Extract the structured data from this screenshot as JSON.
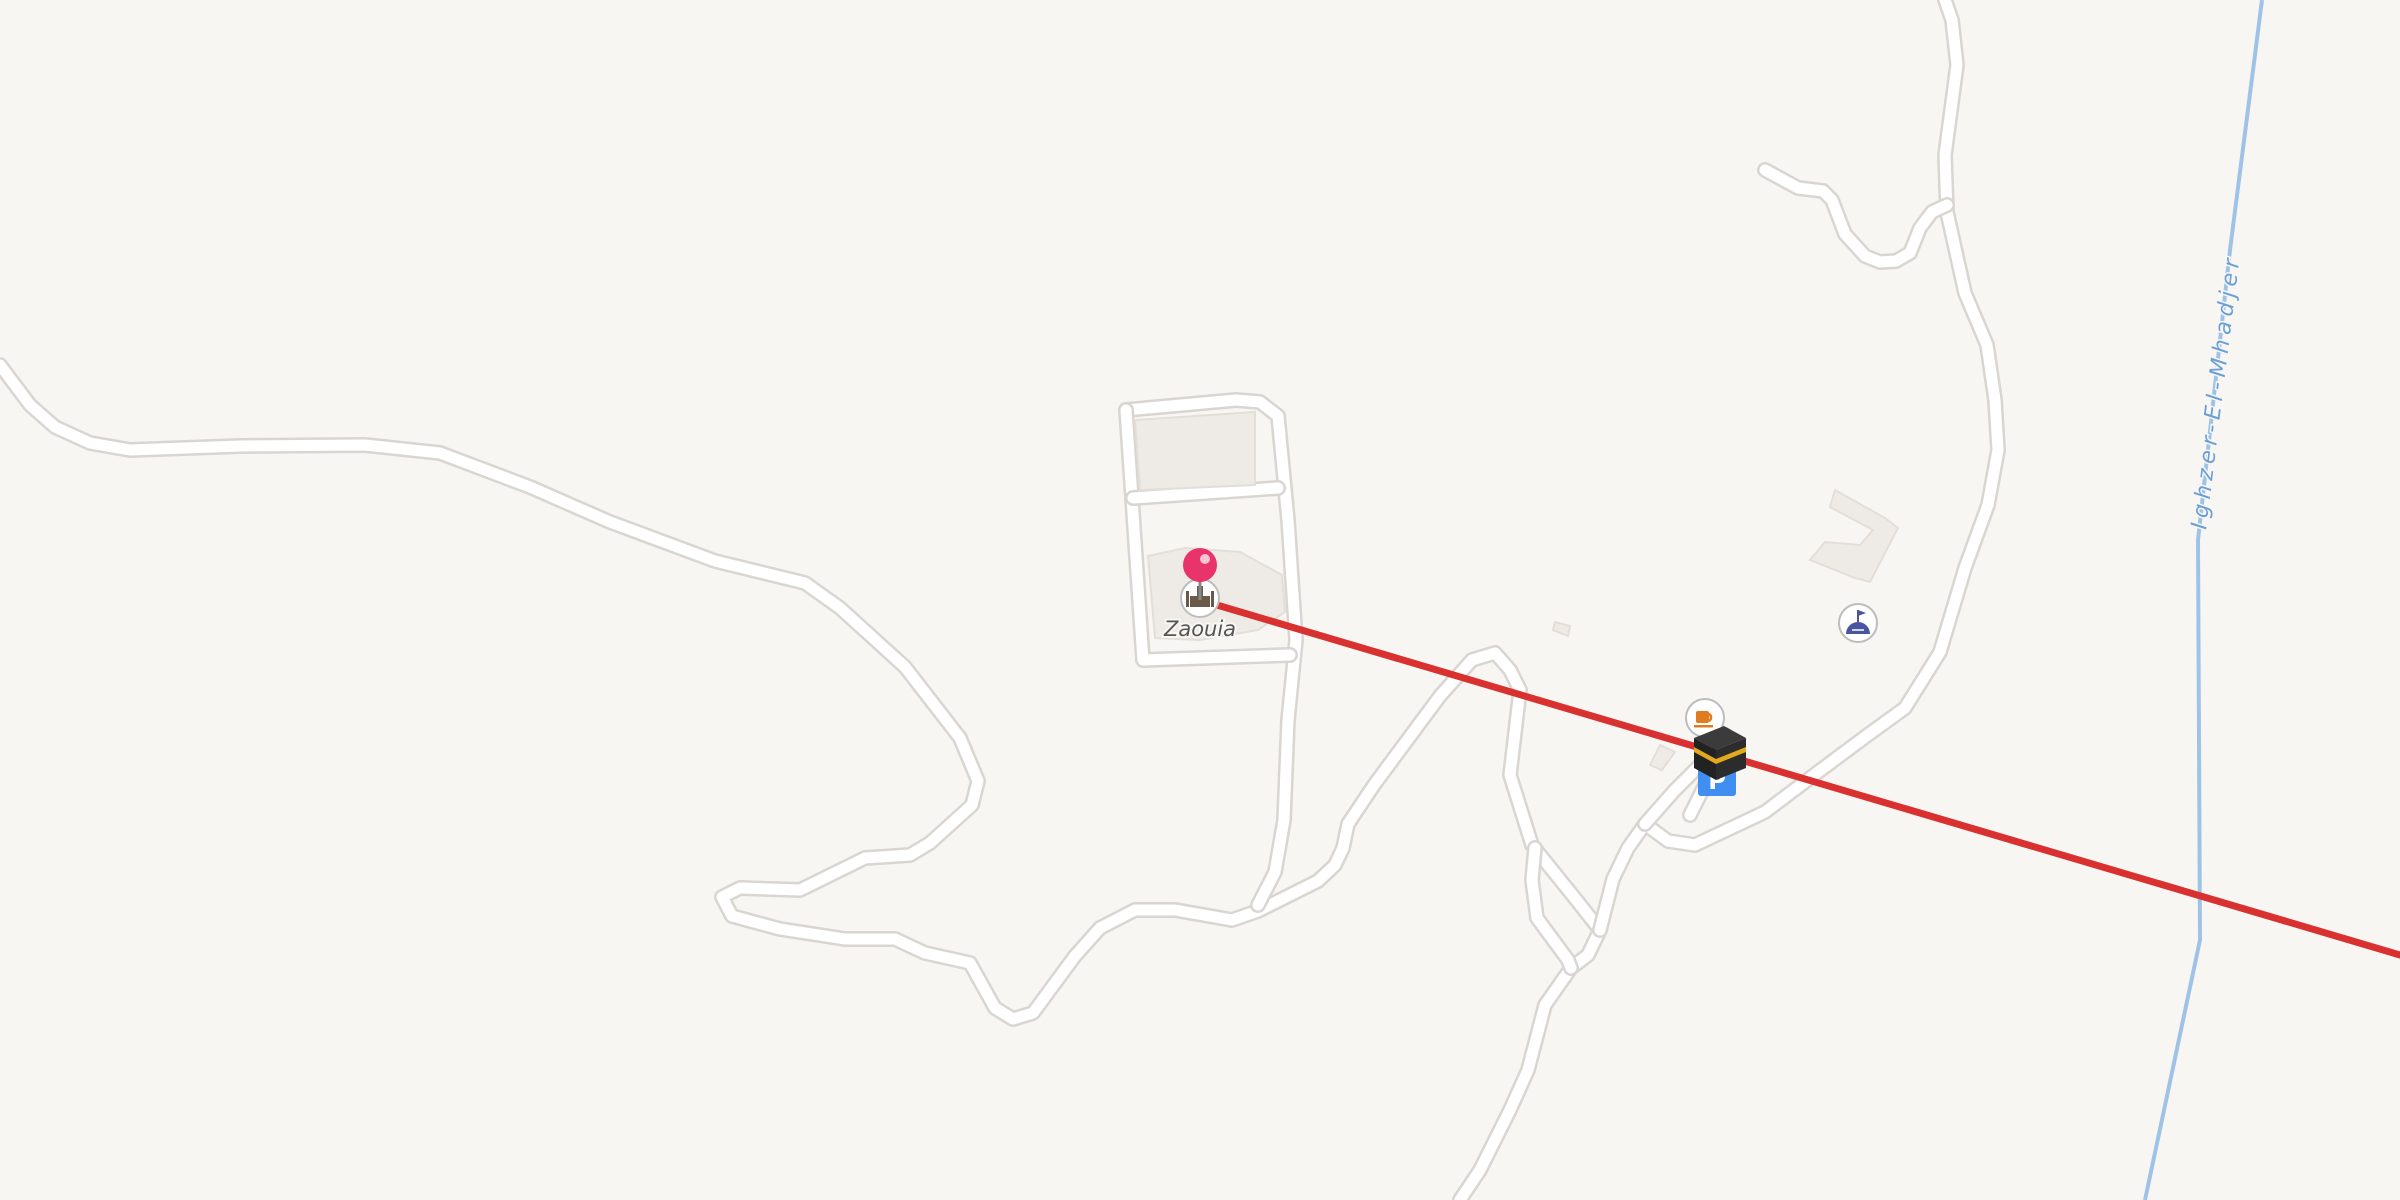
{
  "map": {
    "colors": {
      "background": "#f8f6f3",
      "road": "#ffffff",
      "river": "#9fc3e7",
      "route": "#d93030",
      "pin": "#e8336b",
      "parking": "#3f8ef0"
    },
    "labels": {
      "place": "Zaouia",
      "river": "Ighzer-El-Mhadjer"
    },
    "markers": {
      "destination_pin": "destination-pin-icon",
      "place_icon": "mosque-icon",
      "cafe": "cafe-icon",
      "kaaba": "kaaba-icon",
      "parking": "parking-icon",
      "poi": "flag-poi-icon"
    }
  }
}
